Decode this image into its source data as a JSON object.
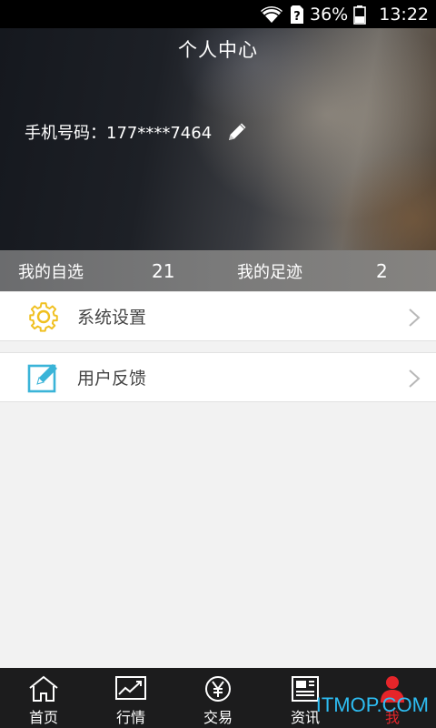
{
  "status_bar": {
    "battery": "36%",
    "time": "13:22",
    "icons": [
      "wifi-icon",
      "sim-unknown-icon",
      "battery-icon"
    ]
  },
  "header": {
    "title": "个人中心",
    "phone": "手机号码：177****7464",
    "edit_icon": "pencil-icon"
  },
  "stats": {
    "favorites": {
      "label": "我的自选",
      "count": "21"
    },
    "footprints": {
      "label": "我的足迹",
      "count": "2"
    }
  },
  "menu": [
    {
      "label": "系统设置",
      "icon": "gear-icon",
      "icon_color": "#f0c020"
    },
    {
      "label": "用户反馈",
      "icon": "edit-note-icon",
      "icon_color": "#3ab4d8"
    }
  ],
  "bottom_nav": {
    "items": [
      {
        "label": "首页",
        "icon": "home-icon"
      },
      {
        "label": "行情",
        "icon": "chart-icon"
      },
      {
        "label": "交易",
        "icon": "yuan-icon"
      },
      {
        "label": "资讯",
        "icon": "news-icon"
      },
      {
        "label": "我",
        "icon": "person-icon",
        "active": true
      }
    ],
    "active_color": "#e5252a"
  },
  "watermark": "ITMOP.COM"
}
